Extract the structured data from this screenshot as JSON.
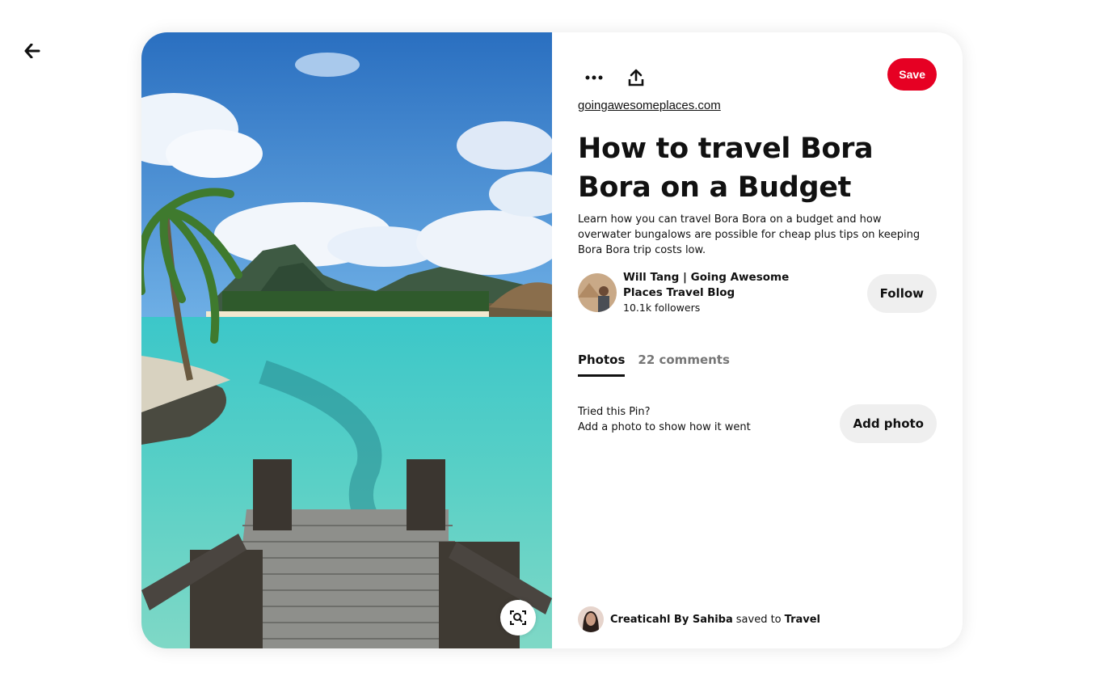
{
  "nav": {
    "back_icon": "arrow-left-icon"
  },
  "pin": {
    "lens_icon": "visual-search-icon",
    "more_icon": "ellipsis-icon",
    "share_icon": "share-upload-icon",
    "save_label": "Save",
    "source_link": "goingawesomeplaces.com",
    "title": "How to travel Bora Bora on a Budget",
    "description": "Learn how you can travel Bora Bora on a budget and how overwater bungalows are possible for cheap plus tips on keeping Bora Bora trip costs low.",
    "creator": {
      "name": "Will Tang | Going Awesome Places Travel Blog",
      "followers": "10.1k followers",
      "follow_label": "Follow"
    },
    "tabs": [
      {
        "label": "Photos",
        "active": true
      },
      {
        "label": "22 comments",
        "active": false
      }
    ],
    "tried": {
      "line1": "Tried this Pin?",
      "line2": "Add a photo to show how it went",
      "button_label": "Add photo"
    },
    "saved_by": {
      "user": "Creaticahl By Sahiba",
      "middle": "saved to",
      "board": "Travel"
    }
  },
  "colors": {
    "save_red": "#e60023",
    "button_gray": "#efefef",
    "inactive_tab": "#767676"
  }
}
